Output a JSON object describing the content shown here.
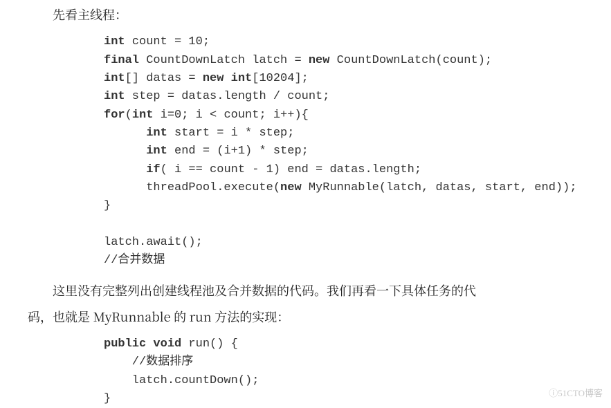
{
  "body": {
    "intro1": "先看主线程：",
    "code1": "int count = 10;\nfinal CountDownLatch latch = new CountDownLatch(count);\nint[] datas = new int[10204];\nint step = datas.length / count;\nfor(int i=0; i < count; i++){\n      int start = i * step;\n      int end = (i+1) * step;\n      if( i == count - 1) end = datas.length;\n      threadPool.execute(new MyRunnable(latch, datas, start, end));\n}\n\nlatch.await();\n//合并数据",
    "para2_line1": "这里没有完整列出创建线程池及合并数据的代码。我们再看一下具体任务的代",
    "para2_line2": "码，也就是 MyRunnable 的 run 方法的实现：",
    "code2": "public void run() {\n    //数据排序\n    latch.countDown();\n}",
    "code1_kw": [
      "int",
      "final",
      "new",
      "int",
      "new",
      "int",
      "int",
      "for",
      "int",
      "int",
      "int",
      "if",
      "new"
    ],
    "code2_kw": [
      "public",
      "void"
    ]
  },
  "watermark": "51CTO博客"
}
